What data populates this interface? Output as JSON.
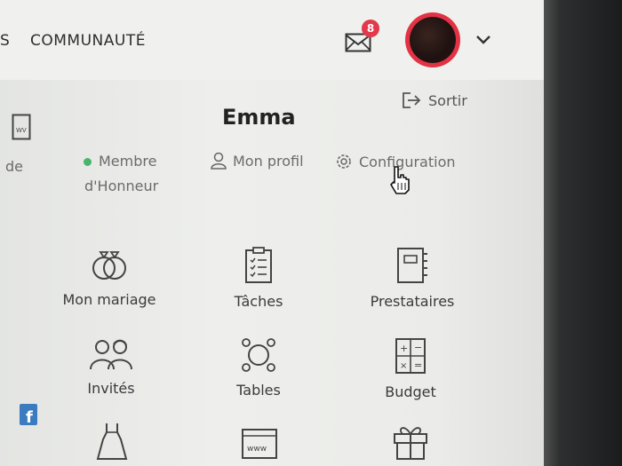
{
  "nav": {
    "partial": "S",
    "community": "COMMUNAUTÉ"
  },
  "messages": {
    "count": "8"
  },
  "account": {
    "logout": "Sortir",
    "name": "Emma"
  },
  "sidebar": {
    "partial_label": "de"
  },
  "profile_links": {
    "status_line1": "Membre",
    "status_line2": "d'Honneur",
    "my_profile": "Mon profil",
    "settings": "Configuration"
  },
  "tiles": [
    {
      "label": "Mon mariage",
      "icon": "rings-icon"
    },
    {
      "label": "Tâches",
      "icon": "checklist-icon"
    },
    {
      "label": "Prestataires",
      "icon": "notebook-icon"
    },
    {
      "label": "Invités",
      "icon": "guests-icon"
    },
    {
      "label": "Tables",
      "icon": "table-icon"
    },
    {
      "label": "Budget",
      "icon": "calculator-icon"
    },
    {
      "label": "",
      "icon": "dress-icon"
    },
    {
      "label": "",
      "icon": "website-icon"
    },
    {
      "label": "",
      "icon": "gift-icon"
    }
  ],
  "colors": {
    "badge": "#e2394b",
    "status_dot": "#4bb46b",
    "facebook": "#3b7bbf"
  }
}
